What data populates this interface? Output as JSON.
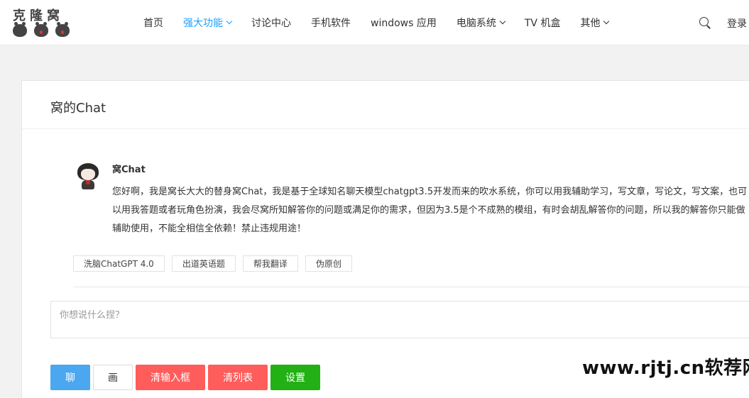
{
  "logo": {
    "text": "克隆窝"
  },
  "nav": {
    "items": [
      {
        "label": "首页",
        "active": false,
        "dropdown": false
      },
      {
        "label": "强大功能",
        "active": true,
        "dropdown": true
      },
      {
        "label": "讨论中心",
        "active": false,
        "dropdown": false
      },
      {
        "label": "手机软件",
        "active": false,
        "dropdown": false
      },
      {
        "label": "windows 应用",
        "active": false,
        "dropdown": false
      },
      {
        "label": "电脑系统",
        "active": false,
        "dropdown": true
      },
      {
        "label": "TV 机盒",
        "active": false,
        "dropdown": false
      },
      {
        "label": "其他",
        "active": false,
        "dropdown": true
      }
    ],
    "search_icon": "search-icon",
    "login_label": "登录"
  },
  "page": {
    "title": "窝的Chat"
  },
  "message": {
    "sender": "窝Chat",
    "text": "您好啊，我是窝长大大的替身窝Chat，我是基于全球知名聊天模型chatgpt3.5开发而来的吹水系统，你可以用我辅助学习，写文章，写论文，写文案，也可以用我答题或者玩角色扮演，我会尽窝所知解答你的问题或满足你的需求，但因为3.5是个不成熟的模组，有时会胡乱解答你的问题，所以我的解答你只能做辅助使用，不能全相信全依赖！禁止违规用途！"
  },
  "quick_actions": [
    "洗脑ChatGPT 4.0",
    "出道英语题",
    "帮我翻译",
    "伪原创"
  ],
  "input": {
    "placeholder": "你想说什么捏？",
    "value": ""
  },
  "buttons": {
    "chat": "聊",
    "draw": "画",
    "clear_input": "清输入框",
    "clear_list": "清列表",
    "settings": "设置"
  },
  "colors": {
    "accent": "#1e9fff",
    "chat_button": "#4ba7ef",
    "danger": "#ff5c5c",
    "success": "#22b014"
  },
  "watermark": "www.rjtj.cn软荐网"
}
